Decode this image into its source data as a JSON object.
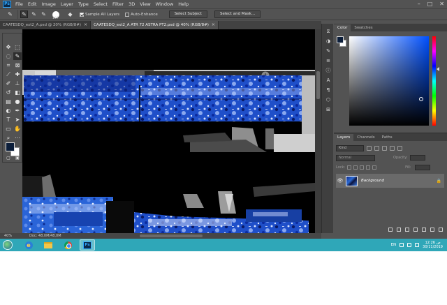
{
  "app": {
    "logo": "Ps"
  },
  "menu": [
    "File",
    "Edit",
    "Image",
    "Layer",
    "Type",
    "Select",
    "Filter",
    "3D",
    "View",
    "Window",
    "Help"
  ],
  "window_controls": {
    "minimize": "–",
    "maximize": "□",
    "close": "✕"
  },
  "options_bar": {
    "brush_size": "107",
    "sample_all_layers": {
      "label": "Sample All Layers",
      "checked": true
    },
    "auto_enhance": {
      "label": "Auto-Enhance",
      "checked": false
    },
    "select_subject": "Select Subject",
    "select_and_mask": "Select and Mask..."
  },
  "tabs": [
    {
      "label": "CAATESDQ_ext2_A.psd @ 20% (RGB/8#)",
      "active": false,
      "close": "×"
    },
    {
      "label": "CAATESDQ_ext2_A ATR 72 ASTRA PT2.psd @ 40% (RGB/8#)",
      "active": true,
      "close": "×"
    }
  ],
  "status": {
    "zoom": "40%",
    "doc": "Doc: 48,0M/48,0M"
  },
  "colors": {
    "foreground": "#0c1e3a",
    "background": "#ffffff",
    "accent": "#31a8ff",
    "taskbar": "#2fa7b8"
  },
  "color_panel": {
    "tabs": [
      "Color",
      "Swatches"
    ]
  },
  "layers_panel": {
    "tabs": [
      "Layers",
      "Channels",
      "Paths"
    ],
    "kind": "Kind",
    "blend_mode": "Normal",
    "opacity_label": "Opacity:",
    "opacity_value": "",
    "lock_label": "Lock:",
    "fill_label": "Fill:",
    "fill_value": "",
    "layers": [
      {
        "name": "Background",
        "visible": true,
        "locked": true
      }
    ]
  },
  "taskbar": {
    "apps": [
      "internet-explorer",
      "file-explorer",
      "chrome",
      "photoshop"
    ],
    "language": "EN",
    "time": "12:26 ص",
    "date": "30/11/2019"
  }
}
